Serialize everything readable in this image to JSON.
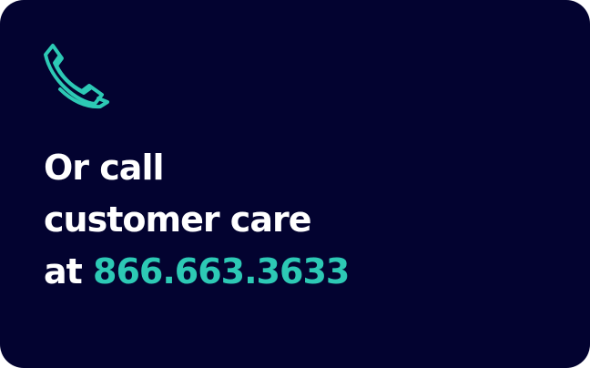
{
  "card": {
    "icon": "phone-icon",
    "line1": "Or call",
    "line2": "customer care",
    "line3_prefix": "at",
    "phone_number": "866.663.3633"
  },
  "colors": {
    "background": "#030330",
    "text": "#ffffff",
    "accent": "#2dc9b5"
  }
}
